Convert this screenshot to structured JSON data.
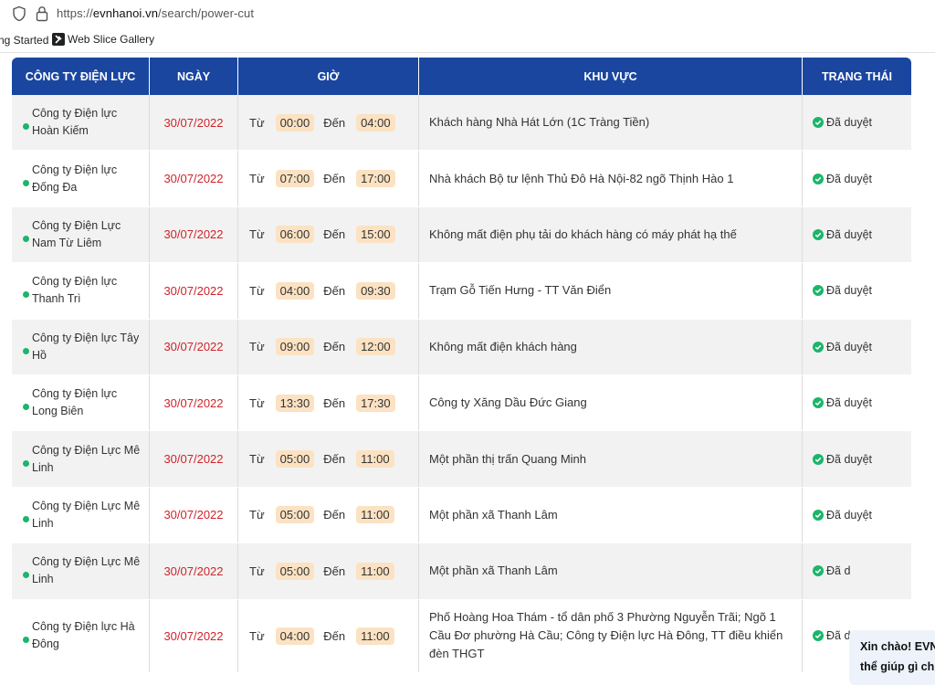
{
  "browser": {
    "url_prefix": "https://",
    "url_host": "evnhanoi.vn",
    "url_path": "/search/power-cut",
    "bookmarks": [
      {
        "label": "ng Started"
      },
      {
        "label": "Web Slice Gallery"
      }
    ]
  },
  "table": {
    "headers": [
      "CÔNG TY ĐIỆN LỰC",
      "NGÀY",
      "GIỜ",
      "KHU VỰC",
      "TRẠNG THÁI"
    ],
    "from_label": "Từ",
    "to_label": "Đến",
    "rows": [
      {
        "company": "Công ty Điện lực Hoàn Kiếm",
        "date": "30/07/2022",
        "from": "00:00",
        "to": "04:00",
        "area": "Khách hàng Nhà Hát Lớn (1C Tràng Tiền)",
        "status": "Đã duyệt"
      },
      {
        "company": "Công ty Điện lực Đống Đa",
        "date": "30/07/2022",
        "from": "07:00",
        "to": "17:00",
        "area": "Nhà khách Bộ tư lệnh Thủ Đô Hà Nội-82 ngõ Thịnh Hào 1",
        "status": "Đã duyệt"
      },
      {
        "company": "Công ty Điện Lực Nam Từ Liêm",
        "date": "30/07/2022",
        "from": "06:00",
        "to": "15:00",
        "area": "Không mất điện phụ tải do khách hàng có máy phát hạ thế",
        "status": "Đã duyệt"
      },
      {
        "company": "Công ty Điện lực Thanh Trì",
        "date": "30/07/2022",
        "from": "04:00",
        "to": "09:30",
        "area": "Trạm Gỗ Tiến Hưng - TT Văn Điển",
        "status": "Đã duyệt"
      },
      {
        "company": "Công ty Điện lực Tây Hồ",
        "date": "30/07/2022",
        "from": "09:00",
        "to": "12:00",
        "area": "Không mất điện khách hàng",
        "status": "Đã duyệt"
      },
      {
        "company": "Công ty Điện lực Long Biên",
        "date": "30/07/2022",
        "from": "13:30",
        "to": "17:30",
        "area": "Công ty Xăng Dầu Đức Giang",
        "status": "Đã duyệt"
      },
      {
        "company": "Công ty Điện Lực Mê Linh",
        "date": "30/07/2022",
        "from": "05:00",
        "to": "11:00",
        "area": "Một phần thị trấn Quang Minh",
        "status": "Đã duyệt"
      },
      {
        "company": "Công ty Điện Lực Mê Linh",
        "date": "30/07/2022",
        "from": "05:00",
        "to": "11:00",
        "area": "Một phần xã Thanh Lâm",
        "status": "Đã duyệt"
      },
      {
        "company": "Công ty Điện Lực Mê Linh",
        "date": "30/07/2022",
        "from": "05:00",
        "to": "11:00",
        "area": "Một phần xã Thanh Lâm",
        "status": "Đã d"
      },
      {
        "company": "Công ty Điện lực Hà Đông",
        "date": "30/07/2022",
        "from": "04:00",
        "to": "11:00",
        "area": "Phố Hoàng Hoa Thám - tổ dân phố 3 Phường Nguyễn Trãi; Ngõ 1 Cầu Đơ phường Hà Cầu; Công ty Điện lực Hà Đông, TT điều khiển đèn THGT",
        "status": "Đã duyệt"
      }
    ]
  },
  "chat": {
    "line1": "Xin chào! EVN",
    "line2": "thể giúp gì ch"
  },
  "colors": {
    "header_bg": "#1a46a0",
    "date": "#d0232a",
    "status_check": "#1bb56b",
    "time_pill": "#fbe2c2"
  }
}
